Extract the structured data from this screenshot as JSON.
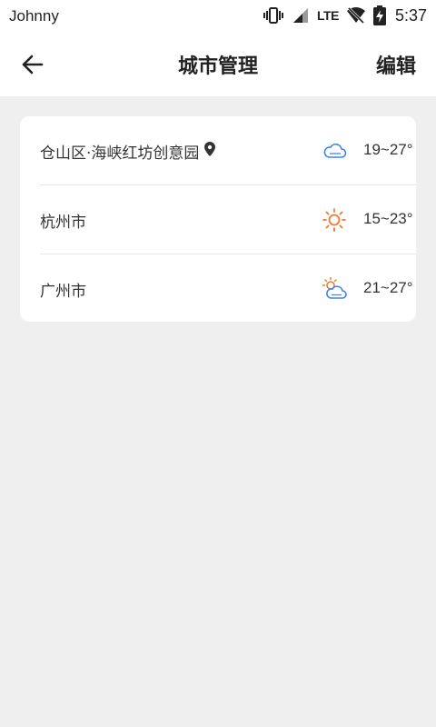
{
  "status_bar": {
    "carrier": "Johnny",
    "network": "LTE",
    "time": "5:37",
    "icons": [
      "vibrate-icon",
      "signal-icon",
      "wifi-off-icon",
      "battery-charging-icon"
    ]
  },
  "header": {
    "back_icon": "arrow-left-icon",
    "title": "城市管理",
    "edit_label": "编辑"
  },
  "cities": [
    {
      "name": "仓山区·海峡红坊创意园",
      "location_icon": "location-pin-icon",
      "weather_icon": "cloudy-icon",
      "temp": "19~27°"
    },
    {
      "name": "杭州市",
      "weather_icon": "sunny-icon",
      "temp": "15~23°"
    },
    {
      "name": "广州市",
      "weather_icon": "partly-cloudy-icon",
      "temp": "21~27°"
    }
  ],
  "colors": {
    "background": "#efefef",
    "card": "#ffffff",
    "cloud": "#3b86e8",
    "sun": "#f07a2e",
    "text": "#333333"
  }
}
